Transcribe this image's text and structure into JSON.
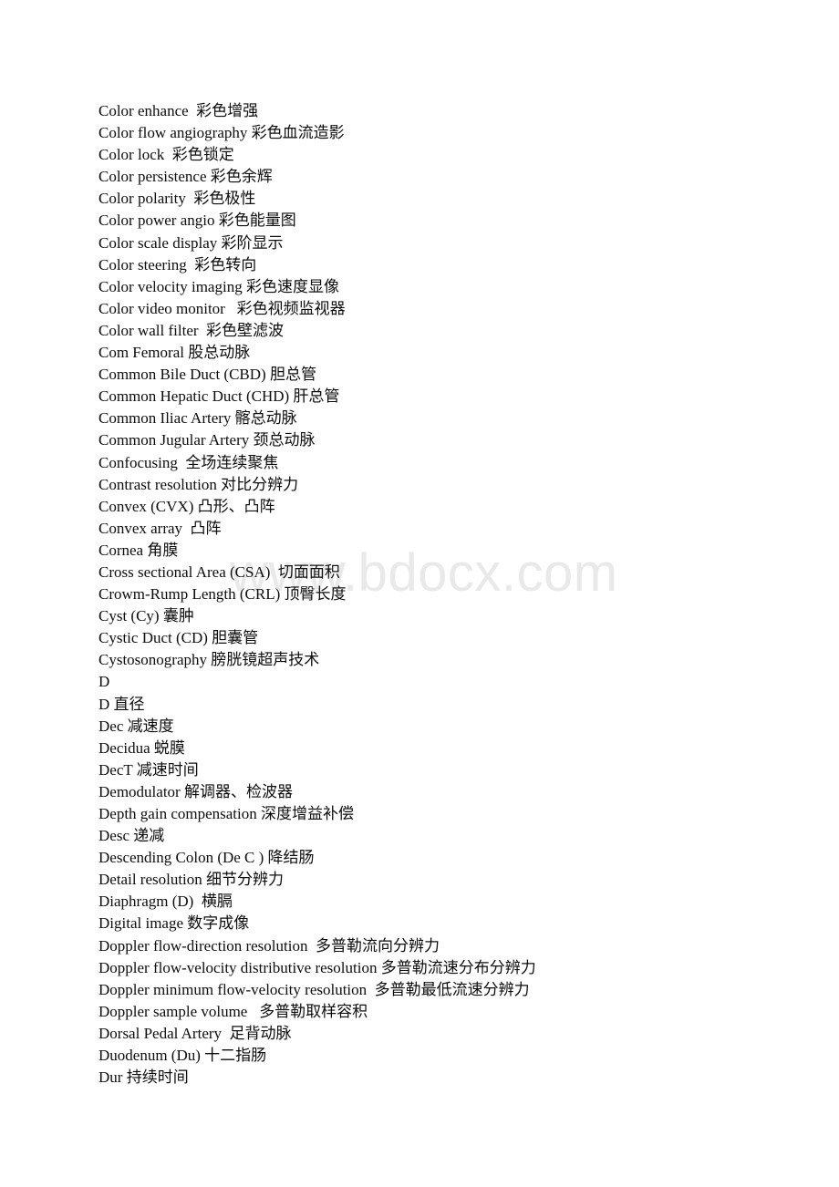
{
  "document": {
    "type": "bilingual-glossary",
    "subject": "ultrasound terminology English-Chinese glossary",
    "watermark": "www.bdocx.com",
    "watermark_color": "#e9e9e9",
    "text_color": "#0d0d0d",
    "background_color": "#ffffff",
    "entries": [
      {
        "id": "color-enhance",
        "text": "Color enhance  彩色增强"
      },
      {
        "id": "color-flow-angiography",
        "text": "Color flow angiography 彩色血流造影"
      },
      {
        "id": "color-lock",
        "text": "Color lock  彩色锁定"
      },
      {
        "id": "color-persistence",
        "text": "Color persistence 彩色余辉"
      },
      {
        "id": "color-polarity",
        "text": "Color polarity  彩色极性"
      },
      {
        "id": "color-power-angio",
        "text": "Color power angio 彩色能量图"
      },
      {
        "id": "color-scale-display",
        "text": "Color scale display 彩阶显示"
      },
      {
        "id": "color-steering",
        "text": "Color steering  彩色转向"
      },
      {
        "id": "color-velocity-imaging",
        "text": "Color velocity imaging 彩色速度显像"
      },
      {
        "id": "color-video-monitor",
        "text": "Color video monitor   彩色视频监视器"
      },
      {
        "id": "color-wall-filter",
        "text": "Color wall filter  彩色壁滤波"
      },
      {
        "id": "com-femoral",
        "text": "Com Femoral 股总动脉"
      },
      {
        "id": "common-bile-duct",
        "text": "Common Bile Duct (CBD) 胆总管"
      },
      {
        "id": "common-hepatic-duct",
        "text": "Common Hepatic Duct (CHD) 肝总管"
      },
      {
        "id": "common-iliac-artery",
        "text": "Common Iliac Artery 髂总动脉"
      },
      {
        "id": "common-jugular-artery",
        "text": "Common Jugular Artery 颈总动脉"
      },
      {
        "id": "confocusing",
        "text": "Confocusing  全场连续聚焦"
      },
      {
        "id": "contrast-resolution",
        "text": "Contrast resolution 对比分辨力"
      },
      {
        "id": "convex-cvx",
        "text": "Convex (CVX) 凸形、凸阵"
      },
      {
        "id": "convex-array",
        "text": "Convex array  凸阵"
      },
      {
        "id": "cornea",
        "text": "Cornea 角膜"
      },
      {
        "id": "cross-sectional-area",
        "text": "Cross sectional Area (CSA)  切面面积"
      },
      {
        "id": "crown-rump-length",
        "text": "Crowm-Rump Length (CRL) 顶臀长度"
      },
      {
        "id": "cyst",
        "text": "Cyst (Cy) 囊肿"
      },
      {
        "id": "cystic-duct",
        "text": "Cystic Duct (CD) 胆囊管"
      },
      {
        "id": "cystosonography",
        "text": "Cystosonography 膀胱镜超声技术"
      },
      {
        "id": "section-d",
        "text": "D"
      },
      {
        "id": "d-diameter",
        "text": "D 直径"
      },
      {
        "id": "dec",
        "text": "Dec 减速度"
      },
      {
        "id": "decidua",
        "text": "Decidua 蜕膜"
      },
      {
        "id": "dect",
        "text": "DecT 减速时间"
      },
      {
        "id": "demodulator",
        "text": "Demodulator 解调器、检波器"
      },
      {
        "id": "depth-gain-compensation",
        "text": "Depth gain compensation 深度增益补偿"
      },
      {
        "id": "desc",
        "text": "Desc 递减"
      },
      {
        "id": "descending-colon",
        "text": "Descending Colon (De C ) 降结肠"
      },
      {
        "id": "detail-resolution",
        "text": "Detail resolution 细节分辨力"
      },
      {
        "id": "diaphragm",
        "text": "Diaphragm (D)  横膈"
      },
      {
        "id": "digital-image",
        "text": "Digital image 数字成像"
      },
      {
        "id": "doppler-flow-direction-resolution",
        "text": "Doppler flow-direction resolution  多普勒流向分辨力"
      },
      {
        "id": "doppler-flow-velocity-distributive-resolution",
        "text": "Doppler flow-velocity distributive resolution 多普勒流速分布分辨力"
      },
      {
        "id": "doppler-minimum-flow-velocity-resolution",
        "text": "Doppler minimum flow-velocity resolution  多普勒最低流速分辨力"
      },
      {
        "id": "doppler-sample-volume",
        "text": "Doppler sample volume   多普勒取样容积"
      },
      {
        "id": "dorsal-pedal-artery",
        "text": "Dorsal Pedal Artery  足背动脉"
      },
      {
        "id": "duodenum",
        "text": "Duodenum (Du) 十二指肠"
      },
      {
        "id": "dur",
        "text": "Dur 持续时间"
      }
    ]
  }
}
